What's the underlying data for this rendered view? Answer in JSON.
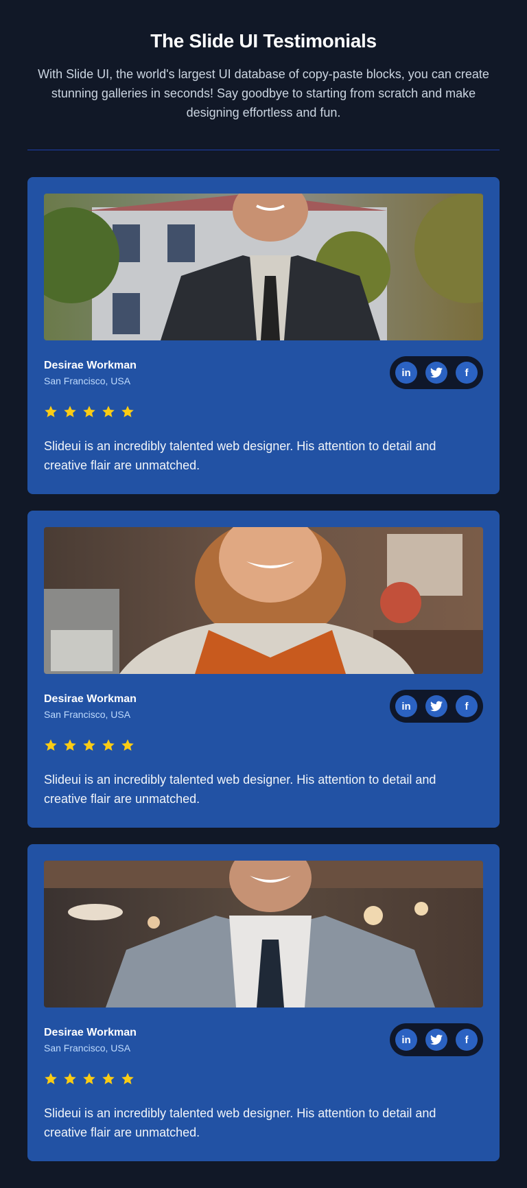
{
  "header": {
    "title": "The Slide UI Testimonials",
    "subtitle": "With Slide UI, the world's largest UI database of copy-paste blocks, you can create stunning galleries in seconds! Say goodbye to starting from scratch and make designing effortless and fun."
  },
  "colors": {
    "background": "#111827",
    "card": "#2252a4",
    "star": "#facc15",
    "social_bg": "#0f172a"
  },
  "testimonials": [
    {
      "name": "Desirae Workman",
      "location": "San Francisco, USA",
      "rating": 5,
      "quote": "Slideui is an incredibly talented web designer. His attention to detail and creative flair are unmatched.",
      "socials": [
        {
          "icon": "linkedin-icon",
          "label": "in"
        },
        {
          "icon": "twitter-icon",
          "label": "🐦"
        },
        {
          "icon": "facebook-icon",
          "label": "f"
        }
      ]
    },
    {
      "name": "Desirae Workman",
      "location": "San Francisco, USA",
      "rating": 5,
      "quote": "Slideui is an incredibly talented web designer. His attention to detail and creative flair are unmatched.",
      "socials": [
        {
          "icon": "linkedin-icon",
          "label": "in"
        },
        {
          "icon": "twitter-icon",
          "label": "🐦"
        },
        {
          "icon": "facebook-icon",
          "label": "f"
        }
      ]
    },
    {
      "name": "Desirae Workman",
      "location": "San Francisco, USA",
      "rating": 5,
      "quote": "Slideui is an incredibly talented web designer. His attention to detail and creative flair are unmatched.",
      "socials": [
        {
          "icon": "linkedin-icon",
          "label": "in"
        },
        {
          "icon": "twitter-icon",
          "label": "🐦"
        },
        {
          "icon": "facebook-icon",
          "label": "f"
        }
      ]
    }
  ]
}
